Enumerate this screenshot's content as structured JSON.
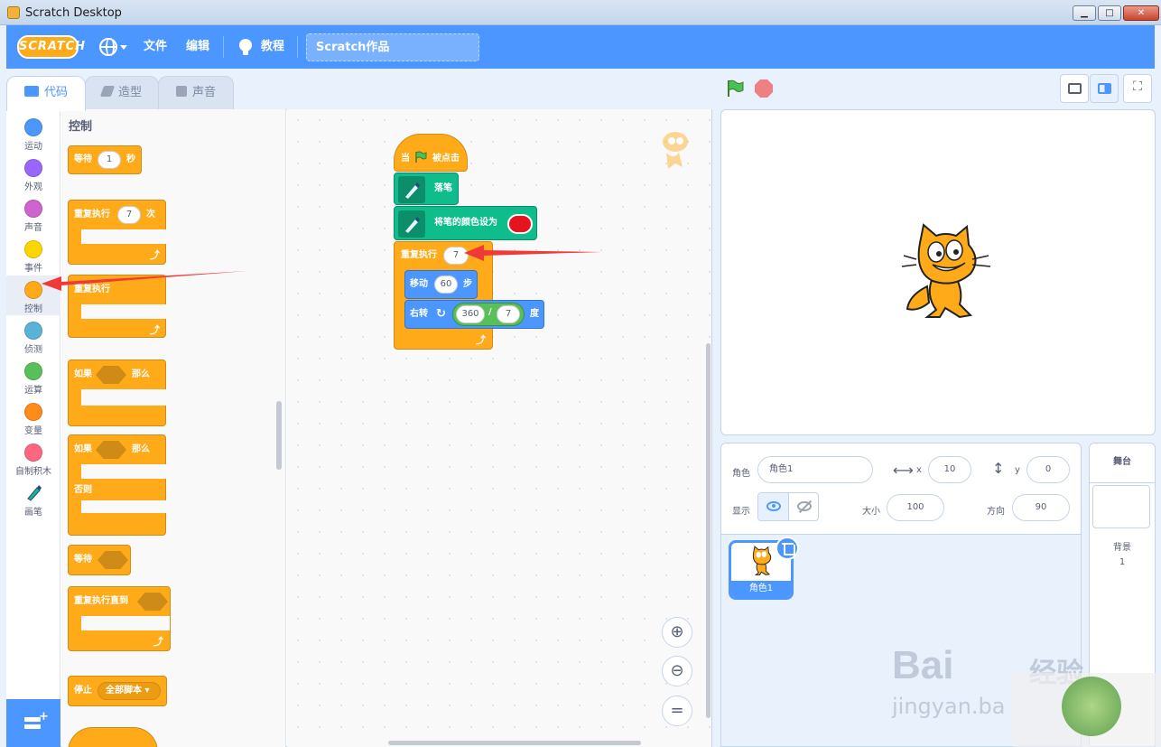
{
  "window": {
    "title": "Scratch Desktop"
  },
  "menu": {
    "logo": "SCRATCH",
    "file": "文件",
    "edit": "编辑",
    "tutorials": "教程",
    "project_title": "Scratch作品"
  },
  "tabs": [
    {
      "label": "代码",
      "active": true
    },
    {
      "label": "造型",
      "active": false
    },
    {
      "label": "声音",
      "active": false
    }
  ],
  "categories": [
    {
      "label": "运动",
      "color": "#4c97ff"
    },
    {
      "label": "外观",
      "color": "#9966ff"
    },
    {
      "label": "声音",
      "color": "#cf63cf"
    },
    {
      "label": "事件",
      "color": "#ffd500"
    },
    {
      "label": "控制",
      "color": "#ffab19"
    },
    {
      "label": "侦测",
      "color": "#5cb1d6"
    },
    {
      "label": "运算",
      "color": "#59c059"
    },
    {
      "label": "变量",
      "color": "#ff8c1a"
    },
    {
      "label": "自制积木",
      "color": "#ff6680"
    },
    {
      "label": "画笔",
      "color": "#0fbd8c"
    }
  ],
  "palette": {
    "title": "控制",
    "wait_label": "等待",
    "wait_value": "1",
    "wait_unit": "秒",
    "repeat_label": "重复执行",
    "repeat_value": "7",
    "repeat_unit": "次",
    "forever_label": "重复执行",
    "if_label": "如果",
    "then_label": "那么",
    "if2_label": "如果",
    "then2_label": "那么",
    "else_label": "否则",
    "wait_until_label": "等待",
    "repeat_until_label": "重复执行直到",
    "stop_label": "停止",
    "stop_option": "全部脚本"
  },
  "script": {
    "hat_when": "当",
    "hat_clicked": "被点击",
    "pen_down": "落笔",
    "set_pen_color": "将笔的颜色设为",
    "pen_color": "#e6141e",
    "repeat_label": "重复执行",
    "repeat_value": "7",
    "repeat_unit": "次",
    "move_label": "移动",
    "move_value": "60",
    "move_unit": "步",
    "turn_label": "右转",
    "turn_a": "360",
    "turn_div": "/",
    "turn_b": "7",
    "turn_unit": "度"
  },
  "sprite_info": {
    "sprite_label": "角色",
    "sprite_name": "角色1",
    "x_label": "x",
    "x_value": "10",
    "y_label": "y",
    "y_value": "0",
    "show_label": "显示",
    "size_label": "大小",
    "size_value": "100",
    "direction_label": "方向",
    "direction_value": "90"
  },
  "sprites": [
    {
      "name": "角色1",
      "selected": true
    }
  ],
  "stage_panel": {
    "title": "舞台",
    "backdrops_label": "背景",
    "backdrops_count": "1"
  },
  "watermarks": {
    "baidu": "Bai",
    "baidu_sub": "jingyan.ba",
    "jing": "经验"
  }
}
